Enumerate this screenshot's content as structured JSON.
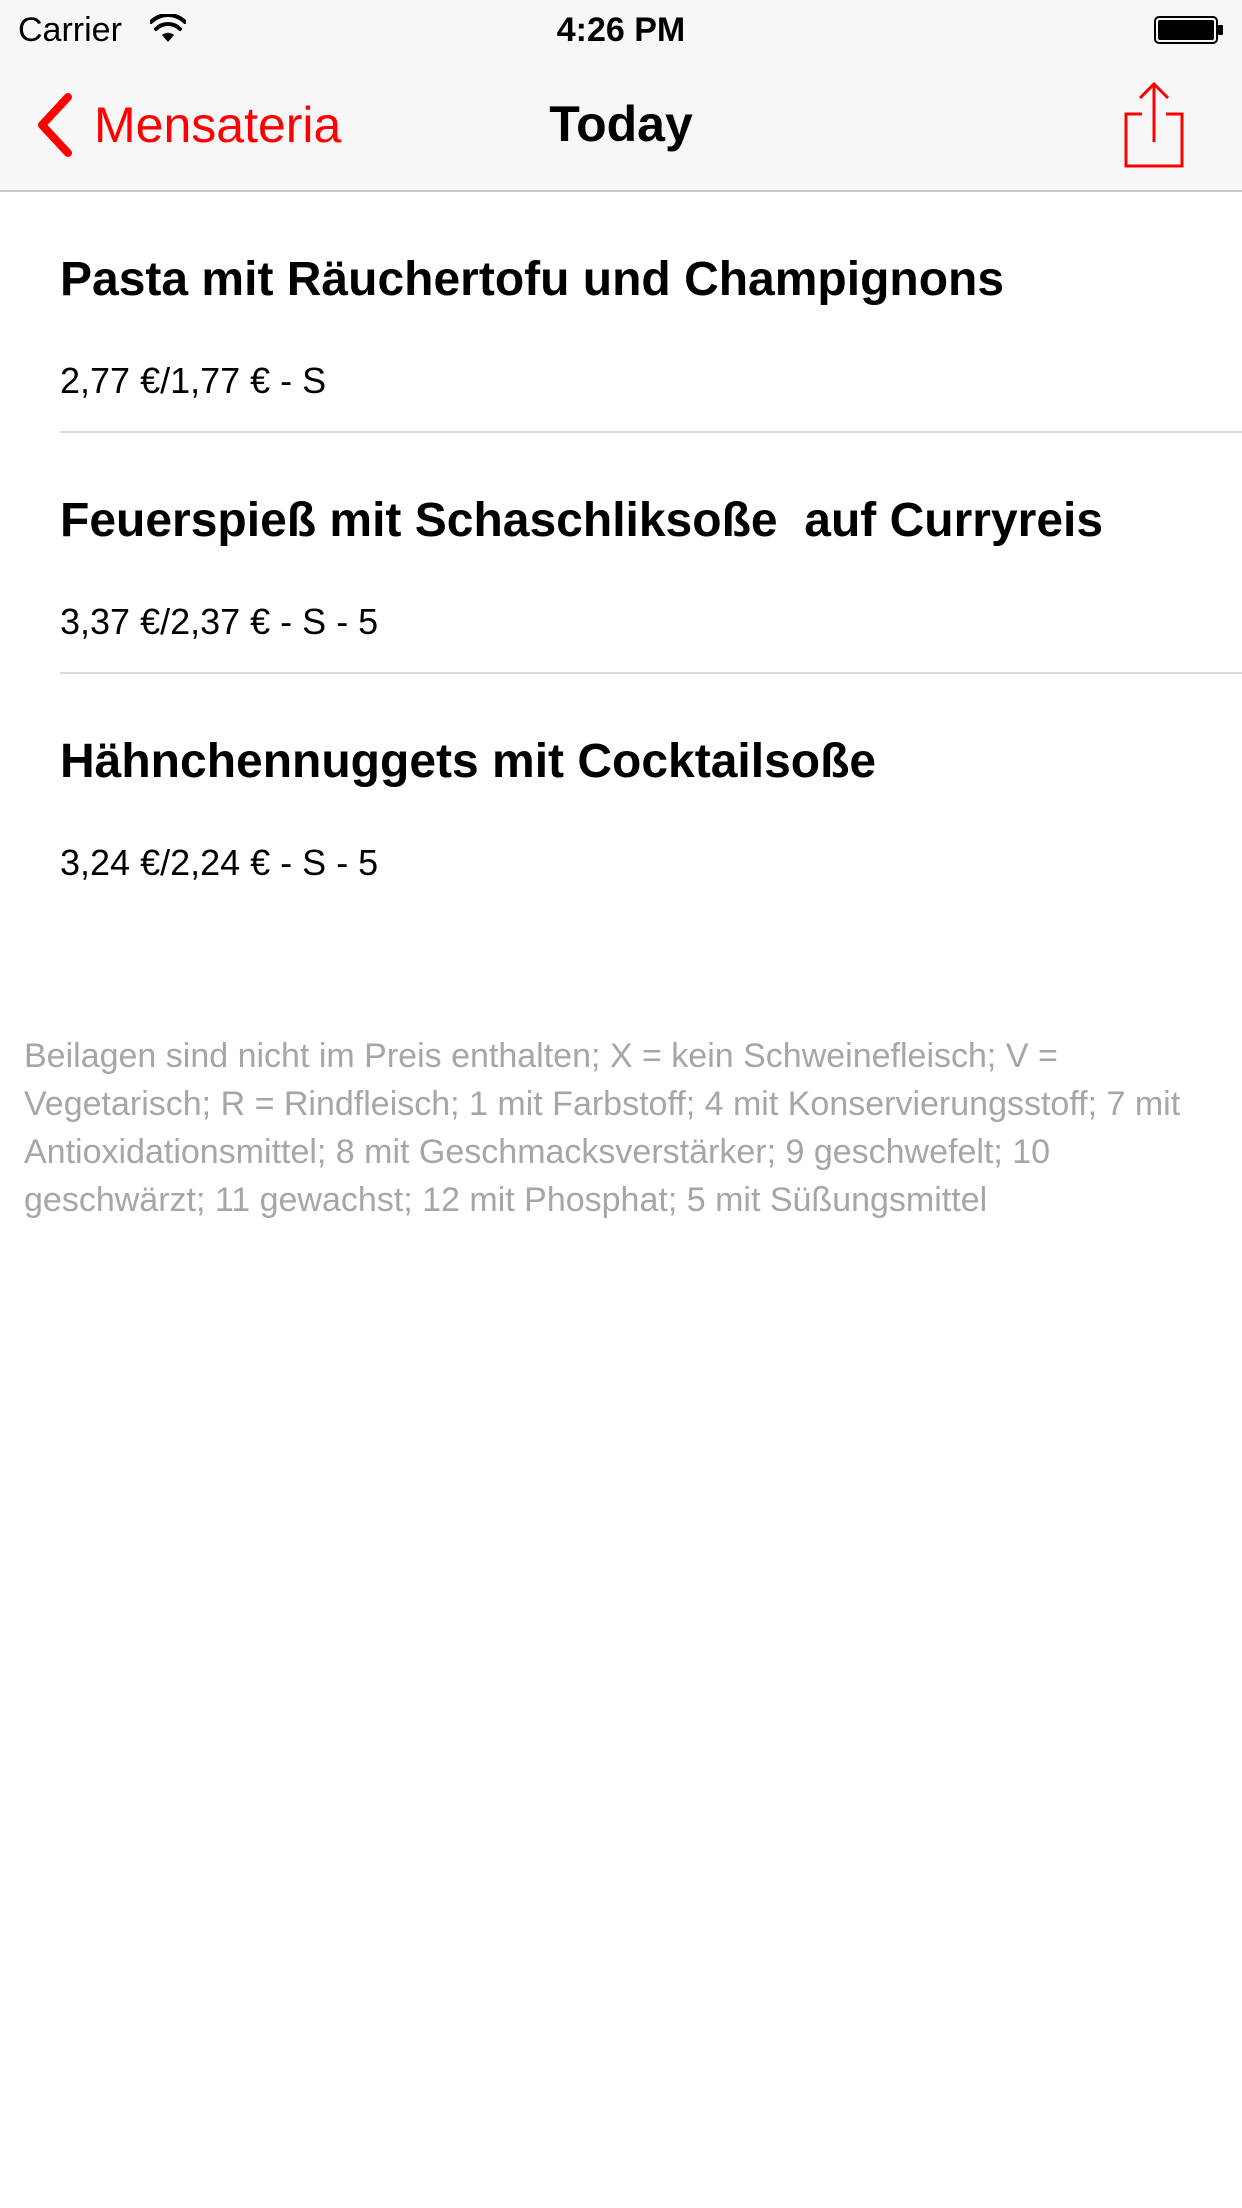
{
  "status_bar": {
    "carrier": "Carrier",
    "time": "4:26 PM",
    "wifi_icon": "wifi-icon",
    "battery_icon": "battery-icon"
  },
  "nav": {
    "back_label": "Mensateria",
    "back_icon": "chevron-left-icon",
    "title": "Today",
    "share_icon": "share-icon",
    "accent_color": "#ff0000"
  },
  "menu": {
    "items": [
      {
        "name": "Pasta mit Räuchertofu und Champignons",
        "price": "2,77 €/1,77 € - S"
      },
      {
        "name": "Feuerspieß mit Schaschliksoße  auf Curryreis",
        "price": "3,37 €/2,37 € - S - 5"
      },
      {
        "name": "Hähnchennuggets mit Cocktailsoße",
        "price": "3,24 €/2,24 € - S - 5"
      }
    ]
  },
  "footnote": "Beilagen sind nicht im Preis enthalten; X = kein Schweinefleisch; V = Vegetarisch; R = Rindfleisch; 1 mit Farbstoff; 4 mit Konservierungsstoff; 7 mit Antioxidationsmittel; 8 mit Geschmacksverstärker; 9 geschwefelt; 10 geschwärzt; 11 gewachst; 12 mit Phosphat; 5 mit Süßungsmittel"
}
